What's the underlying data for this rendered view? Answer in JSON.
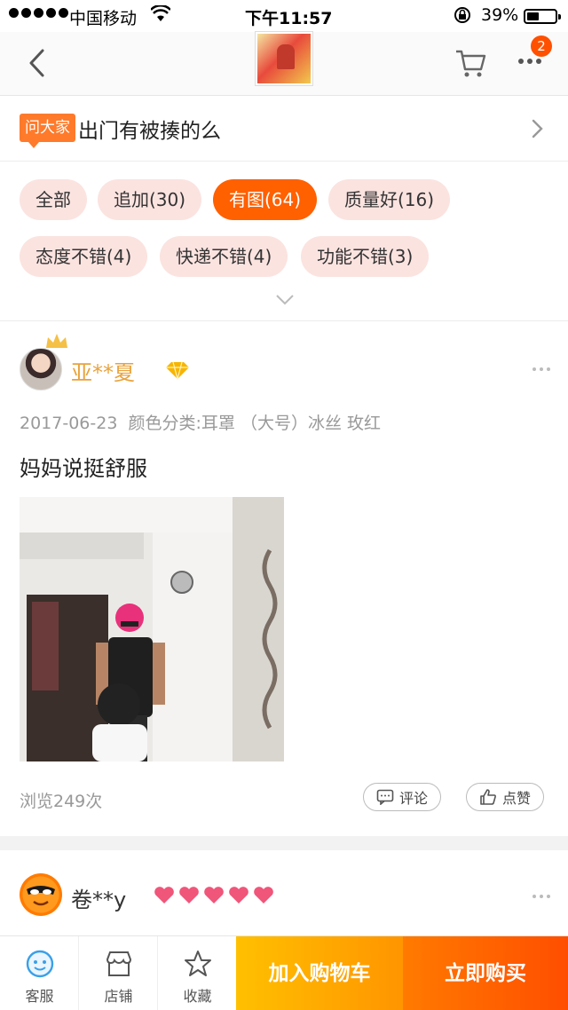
{
  "status_bar": {
    "carrier": "中国移动",
    "time": "下午11:57",
    "battery": "39%"
  },
  "nav": {
    "cart_badge": "2",
    "icons": [
      "back-icon",
      "cart-icon",
      "more-icon"
    ]
  },
  "ask": {
    "tag": "问大家",
    "question": "出门有被揍的么"
  },
  "filters": [
    {
      "label": "全部",
      "active": false
    },
    {
      "label": "追加(30)",
      "active": false
    },
    {
      "label": "有图(64)",
      "active": true
    },
    {
      "label": "质量好(16)",
      "active": false
    },
    {
      "label": "态度不错(4)",
      "active": false
    },
    {
      "label": "快递不错(4)",
      "active": false
    },
    {
      "label": "功能不错(3)",
      "active": false
    }
  ],
  "reviews": [
    {
      "user": "亚**夏",
      "date": "2017-06-23",
      "sku": "颜色分类:耳罩 （大号）冰丝 玫红",
      "content": "妈妈说挺舒服",
      "views": "浏览249次",
      "comment_label": "评论",
      "like_label": "点赞"
    },
    {
      "user": "卷**y"
    }
  ],
  "bottom_bar": {
    "service": "客服",
    "shop": "店铺",
    "favorite": "收藏",
    "add_to_cart": "加入购物车",
    "buy_now": "立即购买"
  },
  "colors": {
    "accent": "#ff5000",
    "chip_bg": "#fbe3e0",
    "username_gold": "#e8a33d"
  }
}
